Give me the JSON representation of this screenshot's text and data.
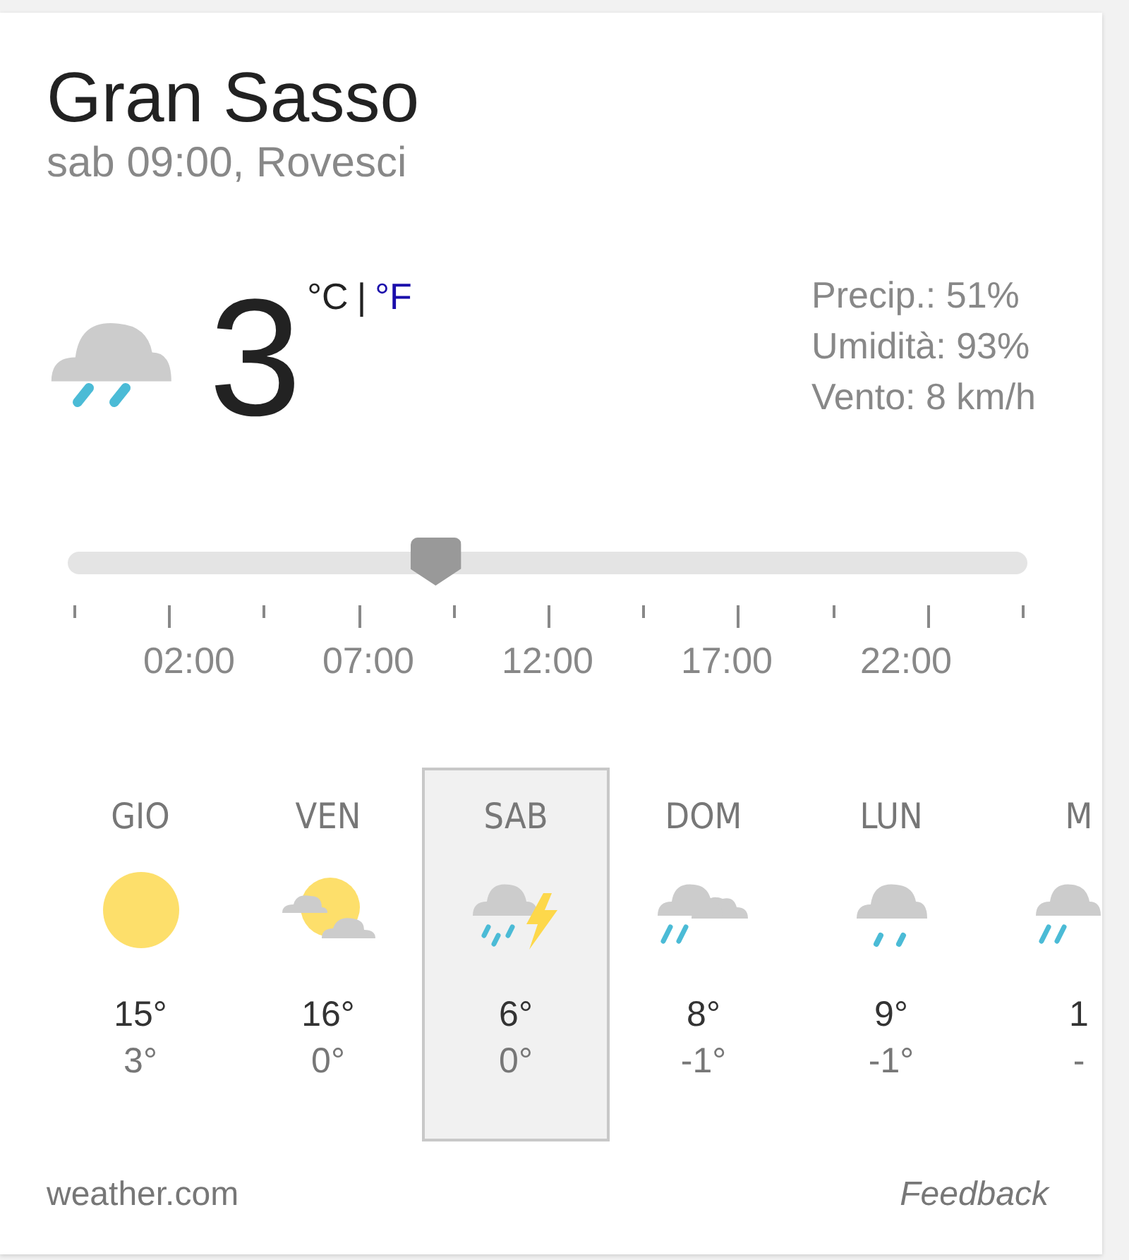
{
  "location": "Gran Sasso",
  "subtitle": "sab 09:00, Rovesci",
  "current": {
    "kind": "rain",
    "temperature": "3",
    "unit_c": "°C",
    "separator": "|",
    "unit_f": "°F",
    "details": [
      "Precip.: 51%",
      "Umidità: 93%",
      "Vento: 8 km/h"
    ]
  },
  "timeline": {
    "level": 0.376,
    "labels": [
      "02:00",
      "07:00",
      "12:00",
      "17:00",
      "22:00"
    ]
  },
  "days": [
    {
      "day": "GIO",
      "kind": "sun",
      "high": "15°",
      "low": "3°",
      "selected": false
    },
    {
      "day": "VEN",
      "kind": "partly-cloudy",
      "high": "16°",
      "low": "0°",
      "selected": false
    },
    {
      "day": "SAB",
      "kind": "thunderstorm",
      "high": "6°",
      "low": "0°",
      "selected": true
    },
    {
      "day": "DOM",
      "kind": "showers-cloudy",
      "high": "8°",
      "low": "-1°",
      "selected": false
    },
    {
      "day": "LUN",
      "kind": "rain",
      "high": "9°",
      "low": "-1°",
      "selected": false
    },
    {
      "day": "M",
      "kind": "showers",
      "high": "1",
      "low": "-",
      "selected": false
    }
  ],
  "footer": {
    "source": "weather.com",
    "feedback": "Feedback"
  }
}
